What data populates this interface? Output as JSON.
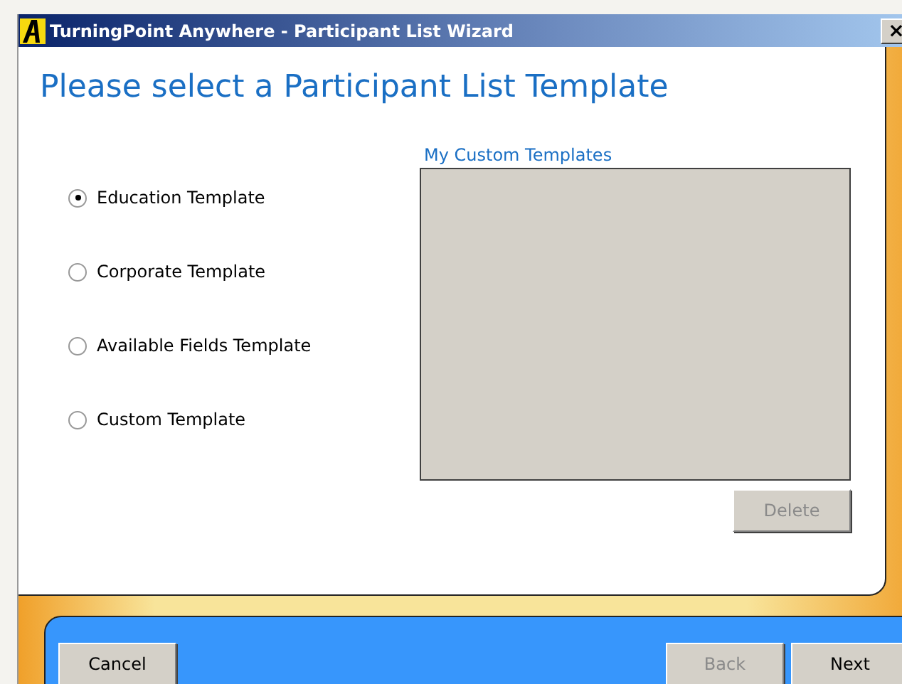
{
  "window": {
    "title": "TurningPoint Anywhere - Participant List Wizard",
    "close": "×"
  },
  "heading": "Please select a Participant List Template",
  "options": [
    {
      "label": "Education Template",
      "selected": true
    },
    {
      "label": "Corporate Template",
      "selected": false
    },
    {
      "label": "Available Fields Template",
      "selected": false
    },
    {
      "label": "Custom Template",
      "selected": false
    }
  ],
  "custom_templates": {
    "label": "My Custom Templates",
    "delete": {
      "label": "Delete",
      "disabled": true
    }
  },
  "buttons": [
    {
      "label": "Cancel",
      "disabled": false
    },
    {
      "label": "Back",
      "disabled": true
    },
    {
      "label": "Next",
      "disabled": false
    }
  ]
}
